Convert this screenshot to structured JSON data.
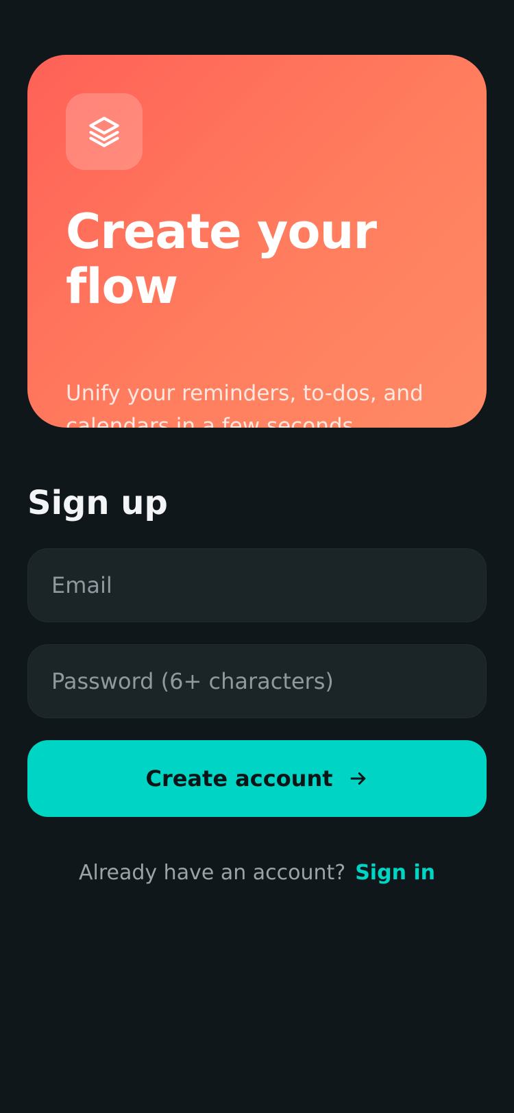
{
  "hero": {
    "icon": "layers-icon",
    "title": "Create your flow",
    "subtitle": "Unify your reminders, to-dos, and calendars in a few seconds."
  },
  "signup": {
    "title": "Sign up",
    "email": {
      "value": "",
      "placeholder": "Email"
    },
    "password": {
      "value": "",
      "placeholder": "Password (6+ characters)"
    },
    "submit_label": "Create account",
    "submit_icon": "arrow-right-icon"
  },
  "footer": {
    "prompt": "Already have an account?",
    "link_label": "Sign in"
  },
  "colors": {
    "background": "#0f171a",
    "hero_gradient_start": "#ff6157",
    "hero_gradient_end": "#ff8a65",
    "accent": "#00d5c5",
    "field_background": "#1b2427"
  }
}
